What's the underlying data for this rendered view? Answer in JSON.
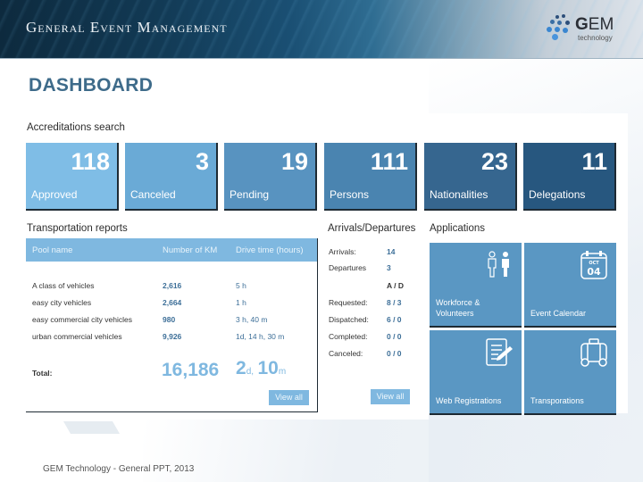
{
  "header": {
    "title": "General Event Management",
    "logo_text_bold": "G",
    "logo_text_rest": "EM",
    "logo_subtext": "technology"
  },
  "page_title": "DASHBOARD",
  "accreditations": {
    "title": "Accreditations search",
    "tiles": [
      {
        "value": "118",
        "label": "Approved",
        "color": "#7fbde6"
      },
      {
        "value": "3",
        "label": "Canceled",
        "color": "#6aaad6"
      },
      {
        "value": "19",
        "label": "Pending",
        "color": "#5893c0"
      },
      {
        "value": "111",
        "label": "Persons",
        "color": "#4a84b0"
      },
      {
        "value": "23",
        "label": "Nationalities",
        "color": "#36668f"
      },
      {
        "value": "11",
        "label": "Delegations",
        "color": "#27577f"
      }
    ]
  },
  "transportation": {
    "title": "Transportation reports",
    "columns": [
      "Pool name",
      "Number of KM",
      "Drive time (hours)"
    ],
    "rows": [
      {
        "pool": "A class of vehicles",
        "km": "2,616",
        "time": "5 h"
      },
      {
        "pool": "easy city vehicles",
        "km": "2,664",
        "time": "1 h"
      },
      {
        "pool": "easy commercial city vehicles",
        "km": "980",
        "time": "3 h, 40 m"
      },
      {
        "pool": "urban commercial vehicles",
        "km": "9,926",
        "time": "1d, 14 h, 30 m"
      }
    ],
    "total_label": "Total:",
    "total_km": "16,186",
    "total_days": "2",
    "total_days_unit": "d,",
    "total_minutes": "10",
    "total_minutes_unit": "m",
    "view_all": "View all"
  },
  "arrivals": {
    "title": "Arrivals/Departures",
    "arrivals_label": "Arrivals:",
    "arrivals_value": "14",
    "departures_label": "Departures",
    "departures_value": "3",
    "ad_header": "A / D",
    "rows": [
      {
        "label": "Requested:",
        "value": "8 / 3"
      },
      {
        "label": "Dispatched:",
        "value": "6 / 0"
      },
      {
        "label": "Completed:",
        "value": "0 / 0"
      },
      {
        "label": "Canceled:",
        "value": "0 / 0"
      }
    ],
    "view_all": "View all"
  },
  "applications": {
    "title": "Applications",
    "items": [
      {
        "label_line1": "Workforce &",
        "label_line2": "Volunteers",
        "icon": "people-icon"
      },
      {
        "label_line1": "",
        "label_line2": "Event Calendar",
        "icon": "calendar-icon",
        "calendar_month": "OCT",
        "calendar_day": "04"
      },
      {
        "label_line1": "",
        "label_line2": "Web Registrations",
        "icon": "document-edit-icon"
      },
      {
        "label_line1": "",
        "label_line2": "Transporations",
        "icon": "suitcase-icon"
      }
    ]
  },
  "footer": "GEM Technology - General PPT, 2013"
}
